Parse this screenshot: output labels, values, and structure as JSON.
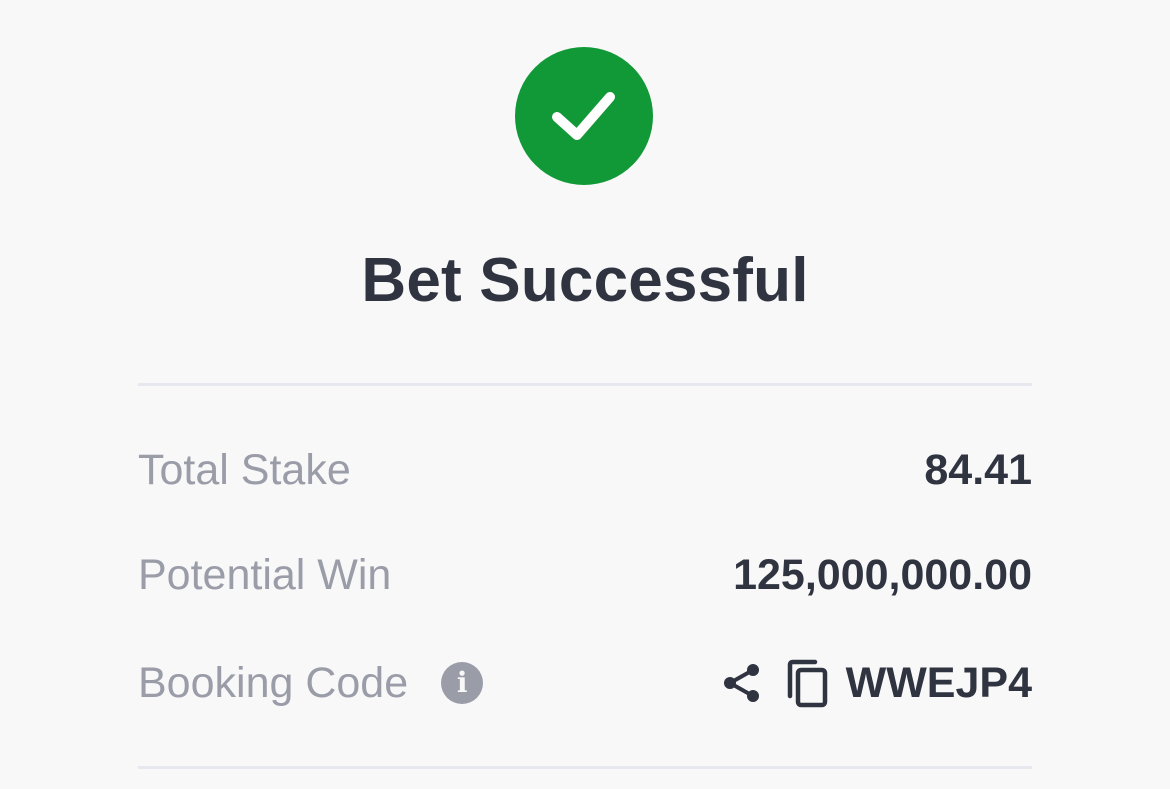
{
  "status": {
    "title": "Bet Successful",
    "icon": "checkmark-icon",
    "color": "#129937"
  },
  "details": {
    "total_stake": {
      "label": "Total Stake",
      "value": "84.41"
    },
    "potential_win": {
      "label": "Potential Win",
      "value": "125,000,000.00"
    },
    "booking_code": {
      "label": "Booking Code",
      "value": "WWEJP4",
      "icons": [
        "info-icon",
        "share-icon",
        "copy-icon"
      ]
    }
  }
}
